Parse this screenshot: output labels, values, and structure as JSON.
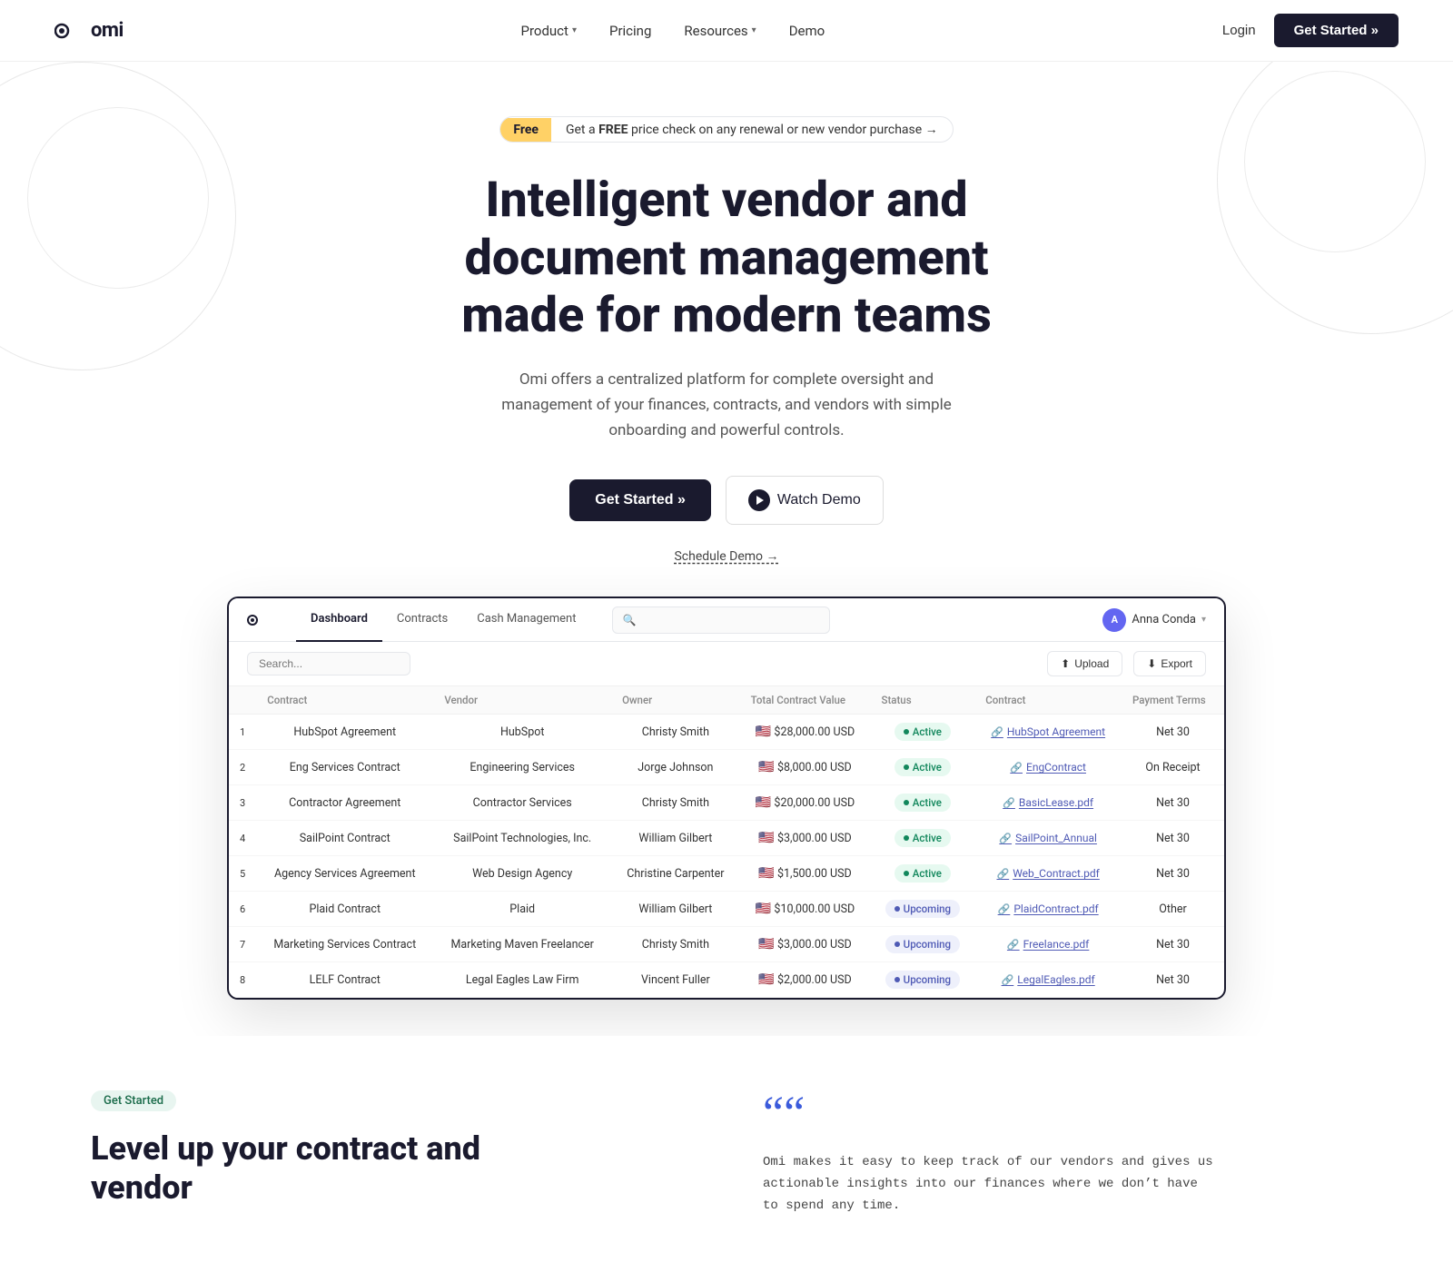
{
  "nav": {
    "logo_text": "omi",
    "links": [
      {
        "label": "Product",
        "has_dropdown": true
      },
      {
        "label": "Pricing",
        "has_dropdown": false
      },
      {
        "label": "Resources",
        "has_dropdown": true
      },
      {
        "label": "Demo",
        "has_dropdown": false
      }
    ],
    "login_label": "Login",
    "get_started_label": "Get Started »"
  },
  "hero": {
    "badge_free": "Free",
    "badge_text": "Get a ",
    "badge_bold": "FREE",
    "badge_rest": " price check on any renewal or new vendor purchase →",
    "title_line1": "Intelligent vendor and document management",
    "title_line2": "made for modern teams",
    "subtitle": "Omi offers a centralized platform for complete oversight and management of your finances, contracts, and vendors with simple onboarding and powerful controls.",
    "btn_get_started": "Get Started »",
    "btn_watch_demo": "Watch Demo",
    "schedule_link": "Schedule Demo →"
  },
  "app": {
    "tabs": [
      {
        "label": "Dashboard",
        "active": true
      },
      {
        "label": "Contracts",
        "active": false
      },
      {
        "label": "Cash Management",
        "active": false
      }
    ],
    "search_placeholder": "Search...",
    "user_name": "Anna Conda",
    "user_initials": "A",
    "toolbar_search_placeholder": "Search...",
    "upload_label": "Upload",
    "export_label": "Export",
    "table": {
      "columns": [
        "Contract",
        "Vendor",
        "Owner",
        "Total Contract Value",
        "Status",
        "Contract",
        "Payment Terms"
      ],
      "rows": [
        {
          "num": 1,
          "contract": "HubSpot Agreement",
          "vendor": "HubSpot",
          "owner": "Christy Smith",
          "value": "$28,000.00 USD",
          "status": "Active",
          "file": "HubSpot Agreement",
          "terms": "Net 30"
        },
        {
          "num": 2,
          "contract": "Eng Services Contract",
          "vendor": "Engineering Services",
          "owner": "Jorge Johnson",
          "value": "$8,000.00 USD",
          "status": "Active",
          "file": "EngContract",
          "terms": "On Receipt"
        },
        {
          "num": 3,
          "contract": "Contractor Agreement",
          "vendor": "Contractor Services",
          "owner": "Christy Smith",
          "value": "$20,000.00 USD",
          "status": "Active",
          "file": "BasicLease.pdf",
          "terms": "Net 30"
        },
        {
          "num": 4,
          "contract": "SailPoint Contract",
          "vendor": "SailPoint Technologies, Inc.",
          "owner": "William Gilbert",
          "value": "$3,000.00 USD",
          "status": "Active",
          "file": "SailPoint_Annual",
          "terms": "Net 30"
        },
        {
          "num": 5,
          "contract": "Agency Services Agreement",
          "vendor": "Web Design Agency",
          "owner": "Christine Carpenter",
          "value": "$1,500.00 USD",
          "status": "Active",
          "file": "Web_Contract.pdf",
          "terms": "Net 30"
        },
        {
          "num": 6,
          "contract": "Plaid Contract",
          "vendor": "Plaid",
          "owner": "William Gilbert",
          "value": "$10,000.00 USD",
          "status": "Upcoming",
          "file": "PlaidContract.pdf",
          "terms": "Other"
        },
        {
          "num": 7,
          "contract": "Marketing Services Contract",
          "vendor": "Marketing Maven Freelancer",
          "owner": "Christy Smith",
          "value": "$3,000.00 USD",
          "status": "Upcoming",
          "file": "Freelance.pdf",
          "terms": "Net 30"
        },
        {
          "num": 8,
          "contract": "LELF Contract",
          "vendor": "Legal Eagles Law Firm",
          "owner": "Vincent Fuller",
          "value": "$2,000.00 USD",
          "status": "Upcoming",
          "file": "LegalEagles.pdf",
          "terms": "Net 30"
        }
      ]
    }
  },
  "bottom": {
    "tag": "Get Started",
    "title_line1": "Level up your contract and vendor",
    "quote_symbol": "““",
    "quote_text": "Omi makes it easy to keep track of our vendors and gives us actionable insights into our finances where we don’t have to spend any time."
  }
}
